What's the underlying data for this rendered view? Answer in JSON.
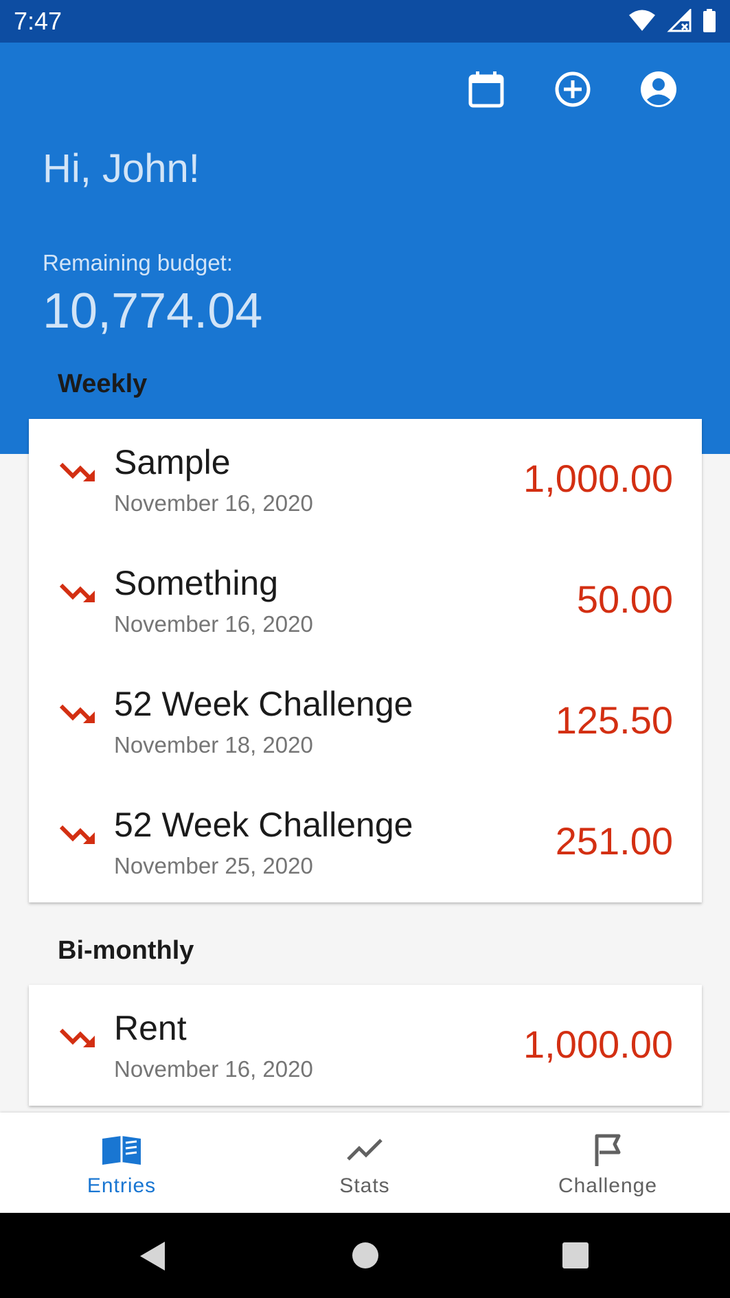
{
  "status_bar": {
    "time": "7:47"
  },
  "header": {
    "greeting": "Hi, John!",
    "budget_label": "Remaining budget:",
    "budget_value": "10,774.04",
    "icons": [
      "calendar-icon",
      "add-circle-icon",
      "account-circle-icon"
    ]
  },
  "sections": [
    {
      "title": "Weekly",
      "entries": [
        {
          "name": "Sample",
          "date": "November 16, 2020",
          "amount": "1,000.00"
        },
        {
          "name": "Something",
          "date": "November 16, 2020",
          "amount": "50.00"
        },
        {
          "name": "52 Week Challenge",
          "date": "November 18, 2020",
          "amount": "125.50"
        },
        {
          "name": "52 Week Challenge",
          "date": "November 25, 2020",
          "amount": "251.00"
        }
      ]
    },
    {
      "title": "Bi-monthly",
      "entries": [
        {
          "name": "Rent",
          "date": "November 16, 2020",
          "amount": "1,000.00"
        }
      ]
    }
  ],
  "bottom_nav": {
    "items": [
      {
        "label": "Entries",
        "icon": "book-icon",
        "active": true
      },
      {
        "label": "Stats",
        "icon": "trending-up-icon",
        "active": false
      },
      {
        "label": "Challenge",
        "icon": "flag-icon",
        "active": false
      }
    ]
  },
  "colors": {
    "primary": "#1976D2",
    "status_bar": "#0D4DA2",
    "expense": "#D32F12",
    "active_nav": "#1976D2",
    "inactive_nav": "#616161"
  }
}
